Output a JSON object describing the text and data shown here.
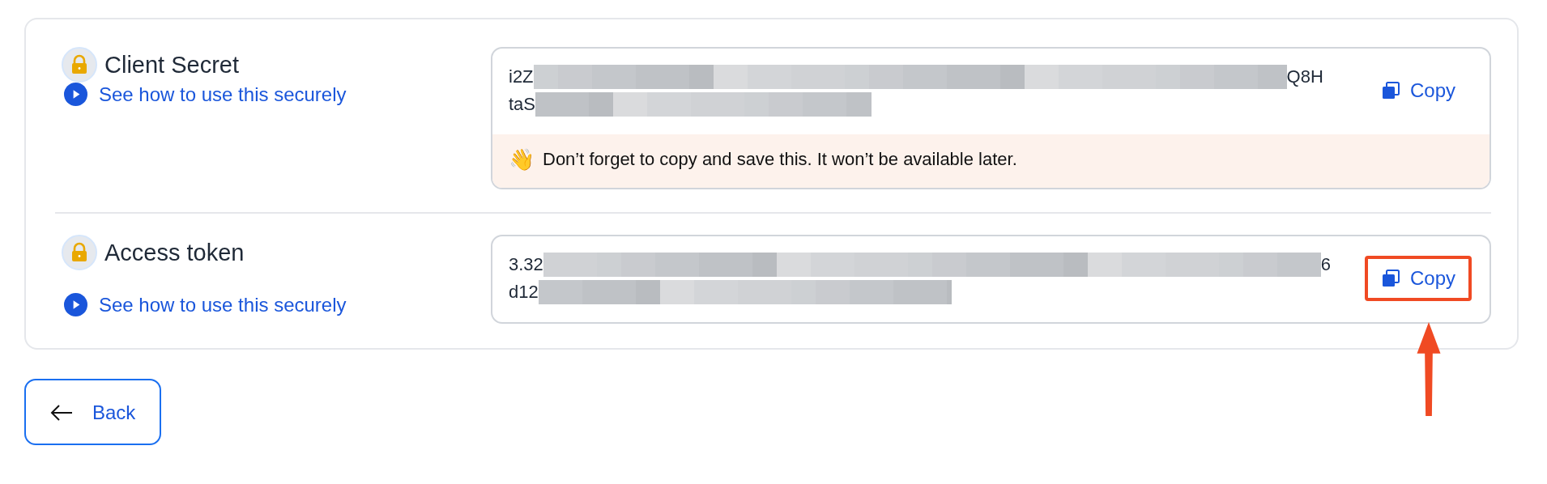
{
  "credentials": [
    {
      "title": "Client Secret",
      "link": "See how to use this securely",
      "value_lines": [
        {
          "start": "i2Z",
          "end": "Q8H"
        },
        {
          "start": "taS"
        }
      ],
      "copy_label": "Copy",
      "copy_highlighted": false,
      "warning": "Don’t forget to copy and save this. It won’t be available later.",
      "warning_emoji": "👋"
    },
    {
      "title": "Access token",
      "link": "See how to use this securely",
      "value_lines": [
        {
          "start": "3.32",
          "end": "6"
        },
        {
          "start": "d12"
        }
      ],
      "copy_label": "Copy",
      "copy_highlighted": true
    }
  ],
  "back_button": {
    "label": "Back"
  }
}
